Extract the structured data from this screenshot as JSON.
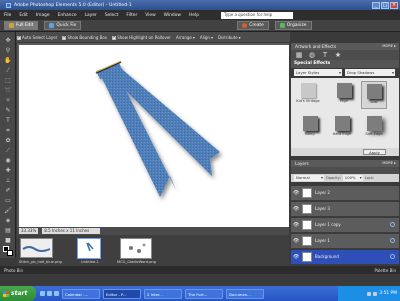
{
  "window": {
    "title": "Adobe Photoshop Elements 5.0 (Editor) - Untitled-1",
    "btn_min": "_",
    "btn_max": "□",
    "btn_close": "×"
  },
  "menu": [
    "File",
    "Edit",
    "Image",
    "Enhance",
    "Layer",
    "Select",
    "Filter",
    "View",
    "Window",
    "Help"
  ],
  "help_placeholder": "Type a question for help",
  "modes": {
    "full_edit": "Full Edit",
    "quick_fix": "Quick Fix",
    "create": "Create",
    "organize": "Organize"
  },
  "options": {
    "auto_select": "Auto Select Layer",
    "bounding_box": "Show Bounding Box",
    "highlight": "Show Highlight on Rollover",
    "arrange": "Arrange",
    "align": "Align",
    "distribute": "Distribute"
  },
  "status": {
    "zoom": "33.33%",
    "doc_size": "8.5 Inches x 11 Inches (300 ppi)"
  },
  "photobin": [
    {
      "label": "Stitch_pb_half_blue.png"
    },
    {
      "label": "Untitled-1"
    },
    {
      "label": "MCG_GiddleWord.png"
    }
  ],
  "lowbar": {
    "left": "Photo Bin",
    "right": "Palette Bin"
  },
  "panels": {
    "artwork_title": "Artwork and Effects",
    "more": "MORE ▸",
    "special_effects": "Special Effects",
    "fx_category": "Layer Styles",
    "fx_subcategory": "Drop Shadows",
    "effects": [
      {
        "label": "Kid's Vintage"
      },
      {
        "label": "High"
      },
      {
        "label": "Low"
      },
      {
        "label": ""
      },
      {
        "label": "Noisy"
      },
      {
        "label": "Hard Edge"
      },
      {
        "label": "Soft Edge"
      }
    ],
    "apply": "Apply",
    "layers_title": "Layers",
    "blend_mode": "Normal",
    "opacity_label": "Opacity:",
    "opacity_value": "100%",
    "lock_label": "Lock:",
    "layers": [
      {
        "name": "Layer 2"
      },
      {
        "name": "Layer 3"
      },
      {
        "name": "Layer 1 copy"
      },
      {
        "name": "Layer 1"
      },
      {
        "name": "Background"
      }
    ]
  },
  "taskbar": {
    "start": "start",
    "tasks": [
      "Calendar -...",
      "Editor - P...",
      "2 Inter...",
      "The Fort...",
      "Documen..."
    ],
    "clock": "3:51 PM"
  },
  "colors": {
    "ribbon": "#4f7fb8",
    "selection": "#2f4fb8"
  }
}
